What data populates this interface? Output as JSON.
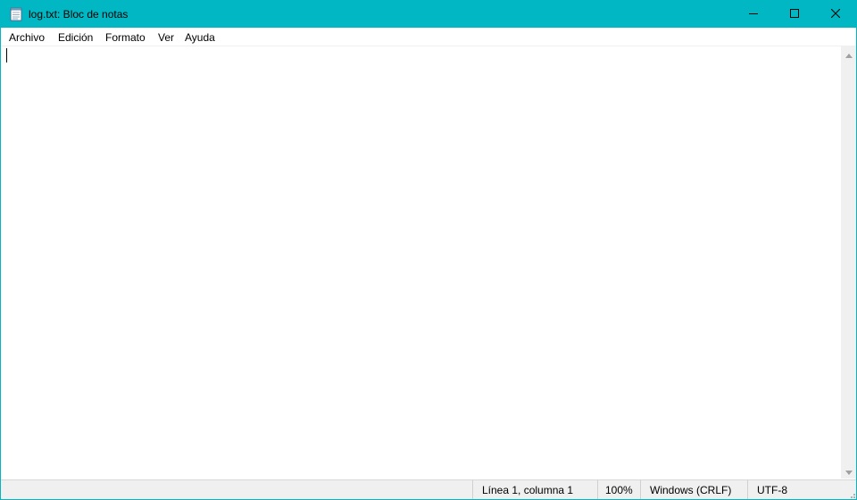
{
  "window": {
    "title": "log.txt: Bloc de notas",
    "accent_color": "#00b7c3",
    "controls": {
      "minimize_icon": "minimize-icon",
      "maximize_icon": "maximize-icon",
      "close_icon": "close-icon"
    }
  },
  "menu": {
    "items": [
      "Archivo",
      "Edición",
      "Formato",
      "Ver",
      "Ayuda"
    ]
  },
  "editor": {
    "content": ""
  },
  "status": {
    "position": "Línea 1, columna 1",
    "zoom": "100%",
    "line_ending": "Windows (CRLF)",
    "encoding": "UTF-8"
  }
}
